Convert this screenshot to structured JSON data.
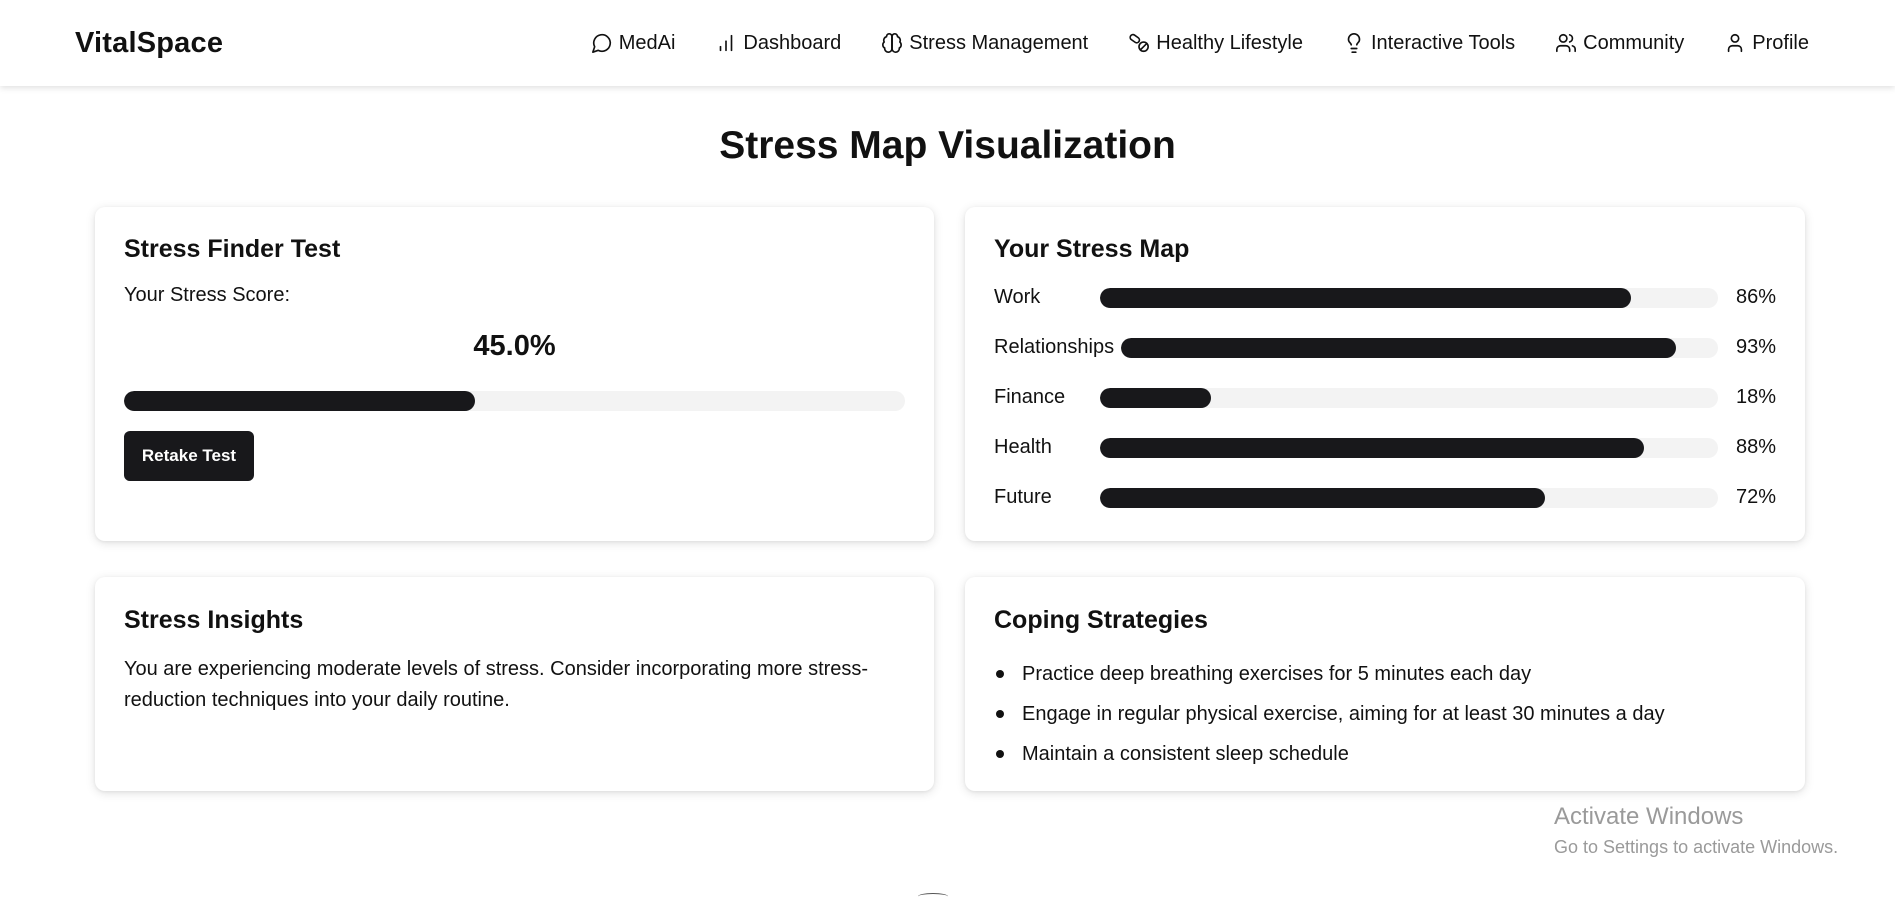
{
  "brand": "VitalSpace",
  "nav": [
    {
      "label": "MedAi",
      "icon": "chat-bubble-icon"
    },
    {
      "label": "Dashboard",
      "icon": "bar-chart-icon"
    },
    {
      "label": "Stress Management",
      "icon": "brain-icon"
    },
    {
      "label": "Healthy Lifestyle",
      "icon": "pills-icon"
    },
    {
      "label": "Interactive Tools",
      "icon": "lightbulb-icon"
    },
    {
      "label": "Community",
      "icon": "users-icon"
    },
    {
      "label": "Profile",
      "icon": "user-icon"
    }
  ],
  "page_title": "Stress Map Visualization",
  "finder": {
    "title": "Stress Finder Test",
    "score_label": "Your Stress Score:",
    "score_text": "45.0%",
    "score_value": 45,
    "retake_label": "Retake Test"
  },
  "stress_map": {
    "title": "Your Stress Map",
    "rows": [
      {
        "label": "Work",
        "value": 86,
        "pct": "86%"
      },
      {
        "label": "Relationships",
        "value": 93,
        "pct": "93%"
      },
      {
        "label": "Finance",
        "value": 18,
        "pct": "18%"
      },
      {
        "label": "Health",
        "value": 88,
        "pct": "88%"
      },
      {
        "label": "Future",
        "value": 72,
        "pct": "72%"
      }
    ]
  },
  "insights": {
    "title": "Stress Insights",
    "text": "You are experiencing moderate levels of stress. Consider incorporating more stress-reduction techniques into your daily routine."
  },
  "coping": {
    "title": "Coping Strategies",
    "items": [
      "Practice deep breathing exercises for 5 minutes each day",
      "Engage in regular physical exercise, aiming for at least 30 minutes a day",
      "Maintain a consistent sleep schedule"
    ]
  },
  "activate_windows": {
    "title": "Activate Windows",
    "subtitle": "Go to Settings to activate Windows."
  },
  "colors": {
    "bar_fill": "#18181b",
    "bar_track": "#f3f3f3",
    "button_bg": "#18181b"
  }
}
